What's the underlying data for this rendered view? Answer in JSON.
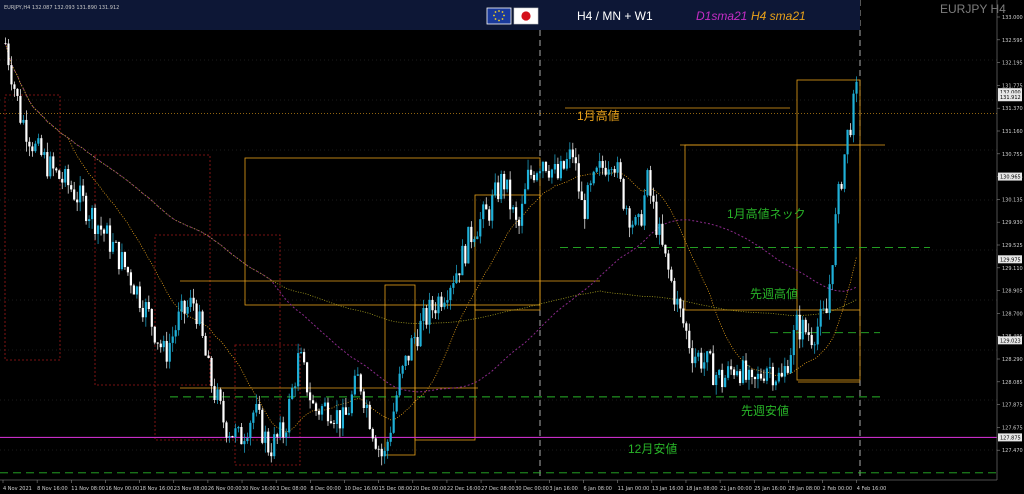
{
  "header": {
    "symbol_info": "EURJPY,H4  132.087 132.093 131.890 131.912",
    "timeframes": "H4 / MN + W1",
    "sma_d1": "D1sma21",
    "sma_h4": "H4 sma21",
    "corner_label": "EURJPY H4",
    "flags": [
      "eu-flag-icon",
      "japan-flag-icon"
    ]
  },
  "colors": {
    "bull": "#1fb0d8",
    "bear": "#ffffff",
    "orange": "#e8a11a",
    "red": "#a01818",
    "green": "#28b428",
    "purple": "#c52dc5",
    "yellowsma": "#a8a020",
    "purple_line": "#8a2a8a"
  },
  "annotations": [
    {
      "id": "jan-high",
      "text": "1月高値",
      "color": "#e8a11a"
    },
    {
      "id": "jan-high-neck",
      "text": "1月高値ネック",
      "color": "#28b428"
    },
    {
      "id": "last-week-high",
      "text": "先週高値",
      "color": "#28b428"
    },
    {
      "id": "last-week-low",
      "text": "先週安値",
      "color": "#28b428"
    },
    {
      "id": "dec-low",
      "text": "12月安値",
      "color": "#28b428"
    }
  ],
  "chart_data": {
    "type": "candlestick",
    "title": "EURJPY,H4",
    "ylim": [
      127.33,
      133.0
    ],
    "y_ticks": [
      "133.000",
      "132.595",
      "132.195",
      "131.775",
      "131.370",
      "131.160",
      "130.755",
      "130.545",
      "130.135",
      "129.930",
      "129.525",
      "129.110",
      "128.905",
      "128.700",
      "128.495",
      "128.290",
      "128.085",
      "127.875",
      "127.675",
      "127.470"
    ],
    "x_ticks": [
      "4 Nov 2021",
      "8 Nov 16:00",
      "11 Nov 08:00",
      "16 Nov 00:00",
      "18 Nov 16:00",
      "23 Nov 08:00",
      "26 Nov 00:00",
      "30 Nov 16:00",
      "3 Dec 08:00",
      "8 Dec 00:00",
      "10 Dec 16:00",
      "15 Dec 08:00",
      "20 Dec 00:00",
      "22 Dec 16:00",
      "27 Dec 08:00",
      "30 Dec 00:00",
      "3 Jan 16:00",
      "6 Jan 08:00",
      "11 Jan 00:00",
      "13 Jan 16:00",
      "18 Jan 08:00",
      "21 Jan 00:00",
      "25 Jan 16:00",
      "28 Jan 08:00",
      "2 Feb 00:00",
      "4 Feb 16:00"
    ],
    "price_markers": [
      {
        "label": "132.000",
        "price": 131.97
      },
      {
        "label": "131.912",
        "price": 131.91
      },
      {
        "label": "130.965",
        "price": 130.97
      },
      {
        "label": "129.975",
        "price": 129.99
      },
      {
        "label": "129.023",
        "price": 129.03
      },
      {
        "label": "127.875",
        "price": 127.88
      }
    ],
    "key_levels": {
      "jan_high": 131.72,
      "jan_high_neck": 130.13,
      "last_week_high": 129.12,
      "last_week_low": 128.36,
      "dec_low": 127.46,
      "purple_level": 127.88
    },
    "path": [
      {
        "t": 0.0,
        "p": 132.55
      },
      {
        "t": 1.5,
        "p": 131.7
      },
      {
        "t": 3.0,
        "p": 131.3
      },
      {
        "t": 5.0,
        "p": 131.0
      },
      {
        "t": 6.5,
        "p": 130.85
      },
      {
        "t": 8.5,
        "p": 130.55
      },
      {
        "t": 10.5,
        "p": 130.2
      },
      {
        "t": 12.5,
        "p": 129.8
      },
      {
        "t": 14.5,
        "p": 129.3
      },
      {
        "t": 16.0,
        "p": 128.85
      },
      {
        "t": 17.5,
        "p": 129.3
      },
      {
        "t": 19.0,
        "p": 129.5
      },
      {
        "t": 20.5,
        "p": 128.6
      },
      {
        "t": 22.0,
        "p": 128.05
      },
      {
        "t": 23.5,
        "p": 127.85
      },
      {
        "t": 25.0,
        "p": 128.2
      },
      {
        "t": 26.5,
        "p": 127.75
      },
      {
        "t": 28.0,
        "p": 127.95
      },
      {
        "t": 29.5,
        "p": 128.85
      },
      {
        "t": 31.0,
        "p": 128.2
      },
      {
        "t": 32.5,
        "p": 128.25
      },
      {
        "t": 34.0,
        "p": 128.05
      },
      {
        "t": 35.5,
        "p": 128.6
      },
      {
        "t": 37.0,
        "p": 127.95
      },
      {
        "t": 38.0,
        "p": 127.6
      },
      {
        "t": 39.5,
        "p": 128.5
      },
      {
        "t": 41.0,
        "p": 129.05
      },
      {
        "t": 42.5,
        "p": 129.35
      },
      {
        "t": 44.0,
        "p": 129.6
      },
      {
        "t": 45.5,
        "p": 129.9
      },
      {
        "t": 47.0,
        "p": 130.35
      },
      {
        "t": 48.5,
        "p": 130.55
      },
      {
        "t": 50.0,
        "p": 130.95
      },
      {
        "t": 51.5,
        "p": 130.3
      },
      {
        "t": 52.5,
        "p": 130.95
      },
      {
        "t": 54.0,
        "p": 131.2
      },
      {
        "t": 55.5,
        "p": 130.95
      },
      {
        "t": 57.0,
        "p": 131.25
      },
      {
        "t": 58.0,
        "p": 130.55
      },
      {
        "t": 59.5,
        "p": 131.0
      },
      {
        "t": 61.0,
        "p": 131.25
      },
      {
        "t": 62.0,
        "p": 130.75
      },
      {
        "t": 63.5,
        "p": 130.3
      },
      {
        "t": 64.5,
        "p": 130.9
      },
      {
        "t": 66.0,
        "p": 130.1
      },
      {
        "t": 67.5,
        "p": 129.45
      },
      {
        "t": 69.0,
        "p": 128.9
      },
      {
        "t": 70.5,
        "p": 128.75
      },
      {
        "t": 72.0,
        "p": 128.55
      },
      {
        "t": 73.5,
        "p": 128.75
      },
      {
        "t": 75.0,
        "p": 128.45
      },
      {
        "t": 76.5,
        "p": 128.75
      },
      {
        "t": 78.0,
        "p": 128.55
      },
      {
        "t": 79.5,
        "p": 129.2
      },
      {
        "t": 81.0,
        "p": 129.1
      },
      {
        "t": 82.5,
        "p": 129.35
      },
      {
        "t": 83.5,
        "p": 130.55
      },
      {
        "t": 84.5,
        "p": 131.4
      },
      {
        "t": 85.5,
        "p": 131.95
      }
    ]
  }
}
